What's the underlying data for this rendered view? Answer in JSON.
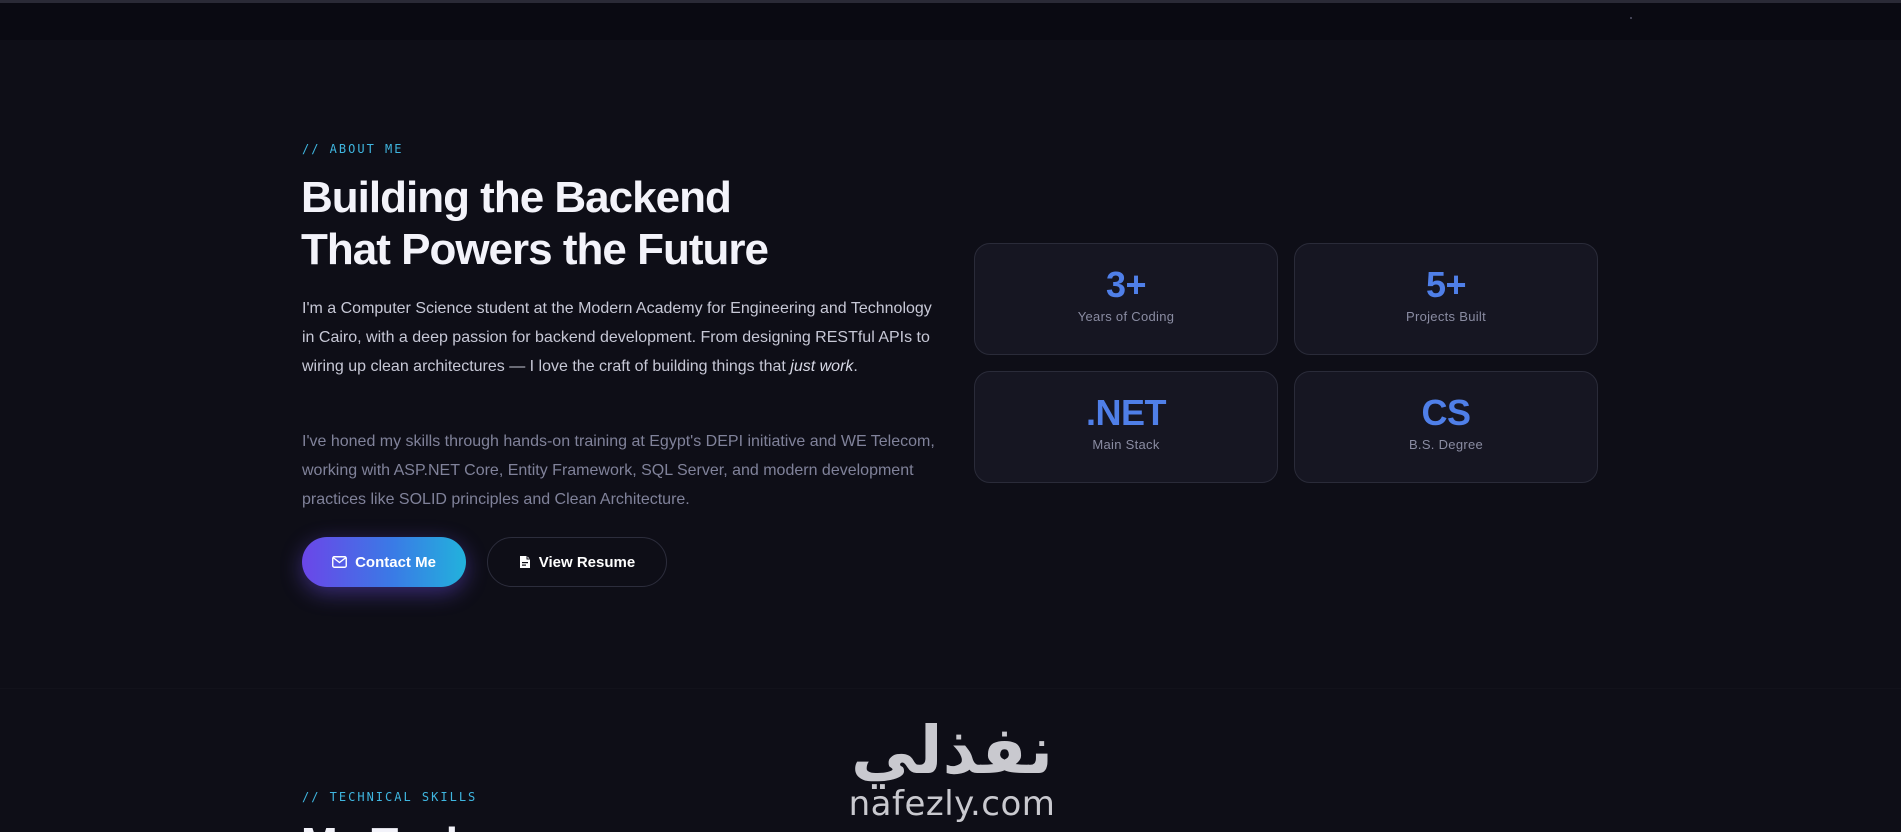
{
  "about": {
    "eyebrow": "// ABOUT ME",
    "headline_line1": "Building the Backend",
    "headline_line2": "That Powers the Future",
    "paragraph1_main": "I'm a Computer Science student at the Modern Academy for Engineering and Technology in Cairo, with a deep passion for backend development. From designing RESTful APIs to wiring up clean architectures — I love the craft of building things that ",
    "paragraph1_emphasis": "just work",
    "paragraph1_end": ".",
    "paragraph2": "I've honed my skills through hands-on training at Egypt's DEPI initiative and WE Telecom, working with ASP.NET Core, Entity Framework, SQL Server, and modern development practices like SOLID principles and Clean Architecture.",
    "contact_button": "Contact Me",
    "resume_button": "View Resume"
  },
  "stats": [
    {
      "value": "3+",
      "label": "Years of Coding"
    },
    {
      "value": "5+",
      "label": "Projects Built"
    },
    {
      "value": ".NET",
      "label": "Main Stack"
    },
    {
      "value": "CS",
      "label": "B.S. Degree"
    }
  ],
  "skills": {
    "eyebrow": "// TECHNICAL SKILLS",
    "heading_partial": "My Tools"
  },
  "watermark": {
    "arabic": "نفذلي",
    "latin": "nafezly.com"
  },
  "colors": {
    "background": "#0e0e17",
    "accent_cyan": "#3fb6e0",
    "stat_blue": "#4f7fe8",
    "gradient_start": "#6b46e8",
    "gradient_end": "#22b2dc"
  },
  "icons": {
    "contact_button_icon": "mail-icon",
    "resume_button_icon": "document-icon"
  }
}
